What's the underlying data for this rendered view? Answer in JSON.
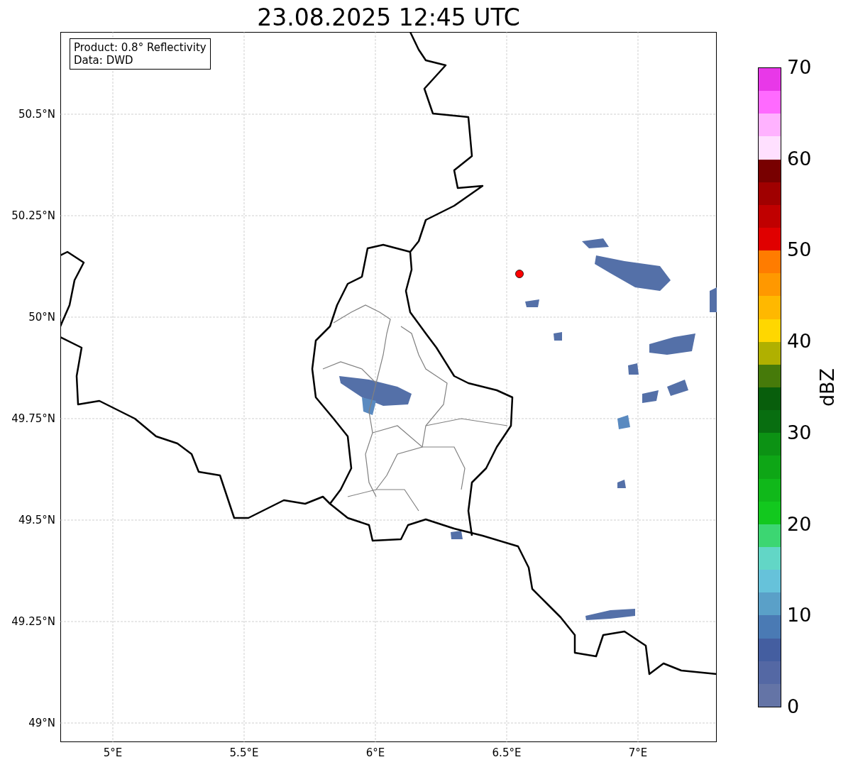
{
  "title": "23.08.2025 12:45 UTC",
  "info_box": [
    "Product: 0.8° Reflectivity",
    "Data: DWD"
  ],
  "map": {
    "xticks": [
      "5°E",
      "5.5°E",
      "6°E",
      "6.5°E",
      "7°E"
    ],
    "yticks": [
      "50.5°N",
      "50.25°N",
      "50°N",
      "49.75°N",
      "49.5°N",
      "49.25°N",
      "49°N"
    ]
  },
  "colorbar": {
    "label": "dBZ",
    "ticks": [
      "70",
      "60",
      "50",
      "40",
      "30",
      "20",
      "10",
      "0"
    ],
    "bands": [
      {
        "color": "#6474a6"
      },
      {
        "color": "#5468a4"
      },
      {
        "color": "#445ea0"
      },
      {
        "color": "#4a7ab4"
      },
      {
        "color": "#5aa0c8"
      },
      {
        "color": "#66c2da"
      },
      {
        "color": "#62d6c6"
      },
      {
        "color": "#3cd672"
      },
      {
        "color": "#12c81e"
      },
      {
        "color": "#10b81a"
      },
      {
        "color": "#0ea616"
      },
      {
        "color": "#0c9214"
      },
      {
        "color": "#086e10"
      },
      {
        "color": "#085e0c"
      },
      {
        "color": "#467a0a"
      },
      {
        "color": "#b0b000"
      },
      {
        "color": "#ffd700"
      },
      {
        "color": "#ffb800"
      },
      {
        "color": "#ff9800"
      },
      {
        "color": "#ff7c00"
      },
      {
        "color": "#e00000"
      },
      {
        "color": "#c00000"
      },
      {
        "color": "#a00000"
      },
      {
        "color": "#780000"
      },
      {
        "color": "#ffe0ff"
      },
      {
        "color": "#ffb2ff"
      },
      {
        "color": "#ff6aff"
      },
      {
        "color": "#e838e8"
      }
    ]
  }
}
